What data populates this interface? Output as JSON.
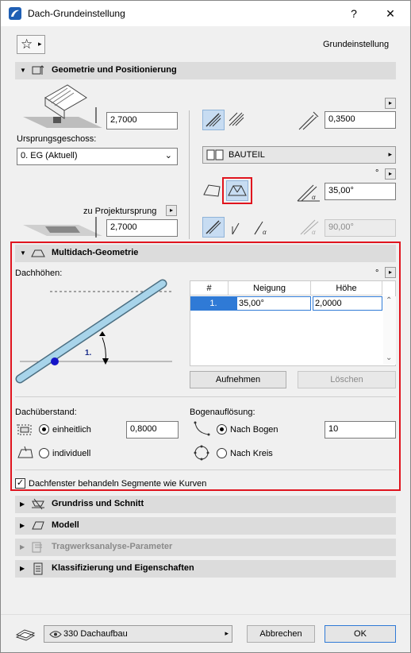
{
  "window": {
    "title": "Dach-Grundeinstellung",
    "help": "?",
    "close": "✕"
  },
  "favorites": {
    "star": "☆",
    "arrow": "▸"
  },
  "header_right": "Grundeinstellung",
  "sections": {
    "geometry": {
      "label": "Geometrie und Positionierung"
    },
    "multiroof": {
      "label": "Multidach-Geometrie"
    },
    "plan": {
      "label": "Grundriss und Schnitt"
    },
    "model": {
      "label": "Modell"
    },
    "structural": {
      "label": "Tragwerksanalyse-Parameter"
    },
    "classification": {
      "label": "Klassifizierung und Eigenschaften"
    }
  },
  "geometry": {
    "height_value": "2,7000",
    "origin_story_label": "Ursprungsgeschoss:",
    "origin_story_value": "0. EG (Aktuell)",
    "project_zero_label": "zu Projektursprung",
    "project_zero_value": "2,7000",
    "thickness_value": "0,3500",
    "bauteil_label": "BAUTEIL",
    "degree_symbol": "°",
    "angle_value": "35,00°",
    "angle2_value": "90,00°"
  },
  "multiroof": {
    "roof_heights_label": "Dachhöhen:",
    "degree_symbol": "°",
    "diagram_label": "1.",
    "table": {
      "headers": [
        "#",
        "Neigung",
        "Höhe"
      ],
      "rows": [
        {
          "num": "1.",
          "pitch": "35,00°",
          "height": "2,0000"
        }
      ]
    },
    "add_button": "Aufnehmen",
    "delete_button": "Löschen",
    "overhang_label": "Dachüberstand:",
    "overhang_uniform": "einheitlich",
    "overhang_individual": "individuell",
    "overhang_value": "0,8000",
    "arc_res_label": "Bogenauflösung:",
    "arc_by_arc": "Nach Bogen",
    "arc_by_circle": "Nach Kreis",
    "arc_value": "10",
    "skylights_label": "Dachfenster behandeln Segmente wie Kurven"
  },
  "footer": {
    "layer_label": "330 Dachaufbau",
    "cancel": "Abbrechen",
    "ok": "OK"
  },
  "colors": {
    "highlight": "#e0141e",
    "roof_blue": "#a8d4ea",
    "selected": "#c7dcf2"
  }
}
